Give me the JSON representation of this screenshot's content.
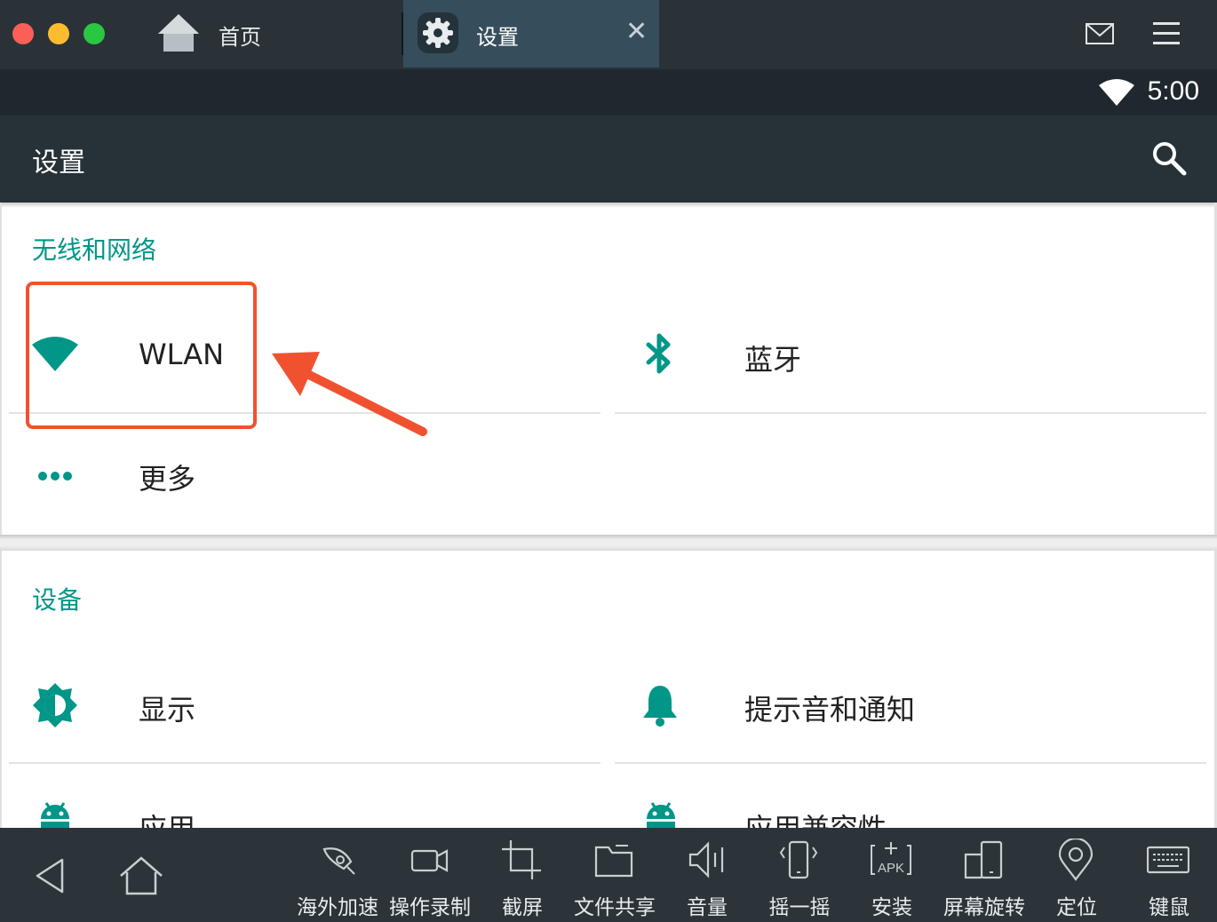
{
  "window": {
    "tabs": [
      {
        "label": "首页",
        "icon": "home-icon"
      },
      {
        "label": "设置",
        "icon": "gear-icon",
        "close": "✕"
      }
    ]
  },
  "status_bar": {
    "time": "5:00",
    "wifi_icon": "wifi-icon"
  },
  "action_bar": {
    "title": "设置",
    "search_icon": "search-icon"
  },
  "sections": [
    {
      "title": "无线和网络",
      "items": [
        {
          "label": "WLAN",
          "icon": "wifi-icon"
        },
        {
          "label": "蓝牙",
          "icon": "bluetooth-icon"
        },
        {
          "label": "更多",
          "icon": "more-dots-icon"
        }
      ]
    },
    {
      "title": "设备",
      "items": [
        {
          "label": "显示",
          "icon": "brightness-icon"
        },
        {
          "label": "提示音和通知",
          "icon": "bell-icon"
        },
        {
          "label": "应用",
          "icon": "android-icon"
        },
        {
          "label": "应用兼容性",
          "icon": "android-icon"
        }
      ]
    }
  ],
  "toolbar": {
    "tools": [
      {
        "label": "海外加速",
        "icon": "rocket-icon"
      },
      {
        "label": "操作录制",
        "icon": "video-camera-icon"
      },
      {
        "label": "截屏",
        "icon": "crop-icon"
      },
      {
        "label": "文件共享",
        "icon": "folder-icon"
      },
      {
        "label": "音量",
        "icon": "volume-icon"
      },
      {
        "label": "摇一摇",
        "icon": "shake-icon"
      },
      {
        "label": "安装",
        "icon": "apk-icon"
      },
      {
        "label": "屏幕旋转",
        "icon": "rotate-icon"
      },
      {
        "label": "定位",
        "icon": "location-pin-icon"
      },
      {
        "label": "键鼠",
        "icon": "keyboard-icon"
      }
    ]
  },
  "colors": {
    "accent": "#009688",
    "highlight": "#f0522f",
    "titlebar": "#2a3238",
    "statusbar": "#1f282e",
    "actionbar": "#263238",
    "toolbar": "#2c3439"
  }
}
